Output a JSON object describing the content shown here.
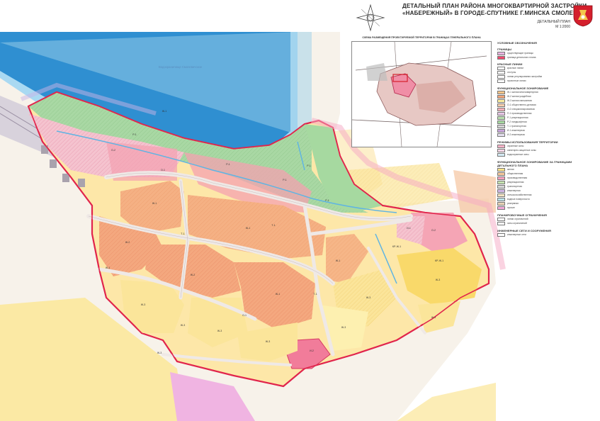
{
  "header": {
    "title_line1": "ДЕТАЛЬНЫЙ ПЛАН РАЙОНА МНОГОКВАРТИРНОЙ ЗАСТРОЙКИ",
    "title_line2": "«НАБЕРЕЖНЫЙ» В ГОРОДЕ-СПУТНИКЕ Г.МИНСКА СМОЛЕВИЧИ",
    "subtitle_line1": "ДЕТАЛЬНЫЙ ПЛАН",
    "subtitle_line2": "М 1:2000"
  },
  "inset": {
    "title": "СХЕМА РАЗМЕЩЕНИЯ ПРОЕКТИРУЕМОЙ ТЕРРИТОРИИ В ГРАНИЦАХ ГЕНЕРАЛЬНОГО ПЛАНА"
  },
  "map": {
    "water_label": "Водохранилище Смолевичское",
    "zone_labels": [
      "Ж-1",
      "Ж-1",
      "Ж-1",
      "Ж-1",
      "Ж-1",
      "Ж-1",
      "Ж-1",
      "Ж-1",
      "Ж-2",
      "Ж-2",
      "Ж-3",
      "Ж-3",
      "Ж-3",
      "Ж-3",
      "Ж-3",
      "Ж-3",
      "Ж-3",
      "Ж-3",
      "О-1",
      "О-1",
      "О-2",
      "О-2",
      "Р-1",
      "Р-1",
      "Р-1",
      "Р-1",
      "Р-1",
      "Т-1",
      "Т-1",
      "Т-1",
      "И-1",
      "И-2",
      "КР-Ж-1",
      "КР-Ж-1",
      "Ж-1",
      "Ж-3"
    ]
  },
  "legend": {
    "heading": "УСЛОВНЫЕ ОБОЗНАЧЕНИЯ",
    "sections": [
      {
        "title": "ГРАНИЦЫ",
        "items": [
          {
            "color": "#e8b4e0",
            "text": "существующие границы"
          },
          {
            "color": "#f04a70",
            "text": "граница детального плана"
          }
        ]
      },
      {
        "title": "КРАСНЫЕ ЛИНИИ",
        "items": [
          {
            "color": "#ffffff",
            "text": "красные линии"
          },
          {
            "color": "#ffffff",
            "text": "отступы"
          },
          {
            "color": "#ffffff",
            "text": "линии регулирования застройки"
          },
          {
            "color": "#ffffff",
            "text": "проектные линии"
          }
        ]
      },
      {
        "title": "ФУНКЦИОНАЛЬНОЕ ЗОНИРОВАНИЕ",
        "items": [
          {
            "color": "#f7c58a",
            "text": "Ж-1 жилая многоквартирная"
          },
          {
            "color": "#f2a679",
            "text": "Ж-2 жилая усадебная"
          },
          {
            "color": "#fbeea0",
            "text": "Ж-3 жилая смешанная"
          },
          {
            "color": "#f9cfae",
            "text": "О-1 общественно-деловая"
          },
          {
            "color": "#ffb0b9",
            "text": "О-2 специализированная"
          },
          {
            "color": "#e9c7e8",
            "text": "П-1 производственная"
          },
          {
            "color": "#b9dfae",
            "text": "Р-1 рекреационная"
          },
          {
            "color": "#a6d9a0",
            "text": "Р-2 ландшафтная"
          },
          {
            "color": "#d5d5d5",
            "text": "Т-1 транспортная"
          },
          {
            "color": "#c9a6dc",
            "text": "И-1 инженерная"
          },
          {
            "color": "#e6e0f0",
            "text": "И-2 инженерная"
          }
        ]
      },
      {
        "title": "РЕЖИМЫ ИСПОЛЬЗОВАНИЯ ТЕРРИТОРИИ",
        "items": [
          {
            "color": "#ffb4c8",
            "text": "охранные зоны"
          },
          {
            "color": "#f9d8e8",
            "text": "санитарно-защитные зоны"
          },
          {
            "color": "#d6ecf6",
            "text": "водоохранные зоны"
          }
        ]
      },
      {
        "title": "ФУНКЦИОНАЛЬНОЕ ЗОНИРОВАНИЕ ЗА ГРАНИЦАМИ ДЕТАЛЬНОГО ПЛАНА",
        "items": [
          {
            "color": "#fbe28a",
            "text": "жилая"
          },
          {
            "color": "#f6c79a",
            "text": "общественная"
          },
          {
            "color": "#f7a2be",
            "text": "производственная"
          },
          {
            "color": "#c6e3b0",
            "text": "рекреационная"
          },
          {
            "color": "#d7d7d7",
            "text": "транспортная"
          },
          {
            "color": "#d1b6e6",
            "text": "инженерная"
          },
          {
            "color": "#f4e4c4",
            "text": "сельскохозяйственная"
          },
          {
            "color": "#bde3e9",
            "text": "водные поверхности"
          },
          {
            "color": "#e9d3b6",
            "text": "резервная"
          },
          {
            "color": "#f2a9d9",
            "text": "прочие"
          }
        ]
      },
      {
        "title": "ПЛАНИРОВОЧНЫЕ ОГРАНИЧЕНИЯ",
        "items": [
          {
            "color": "#ffffff",
            "text": "линии ограничений"
          },
          {
            "color": "#ffffff",
            "text": "зоны ограничений"
          }
        ]
      },
      {
        "title": "ИНЖЕНЕРНЫЕ СЕТИ И СООРУЖЕНИЯ",
        "items": [
          {
            "color": "#ffffff",
            "text": "инженерные сети"
          }
        ]
      }
    ]
  },
  "colors": {
    "water": "#2f8fd1",
    "water_light": "#a9d9f2",
    "boundary": "#e1254c",
    "road": "#f0ecec",
    "residential_orange": "#f2a679",
    "residential_yellow": "#fbe7a0",
    "green": "#a6d9a0",
    "pink": "#f7b0c3"
  }
}
